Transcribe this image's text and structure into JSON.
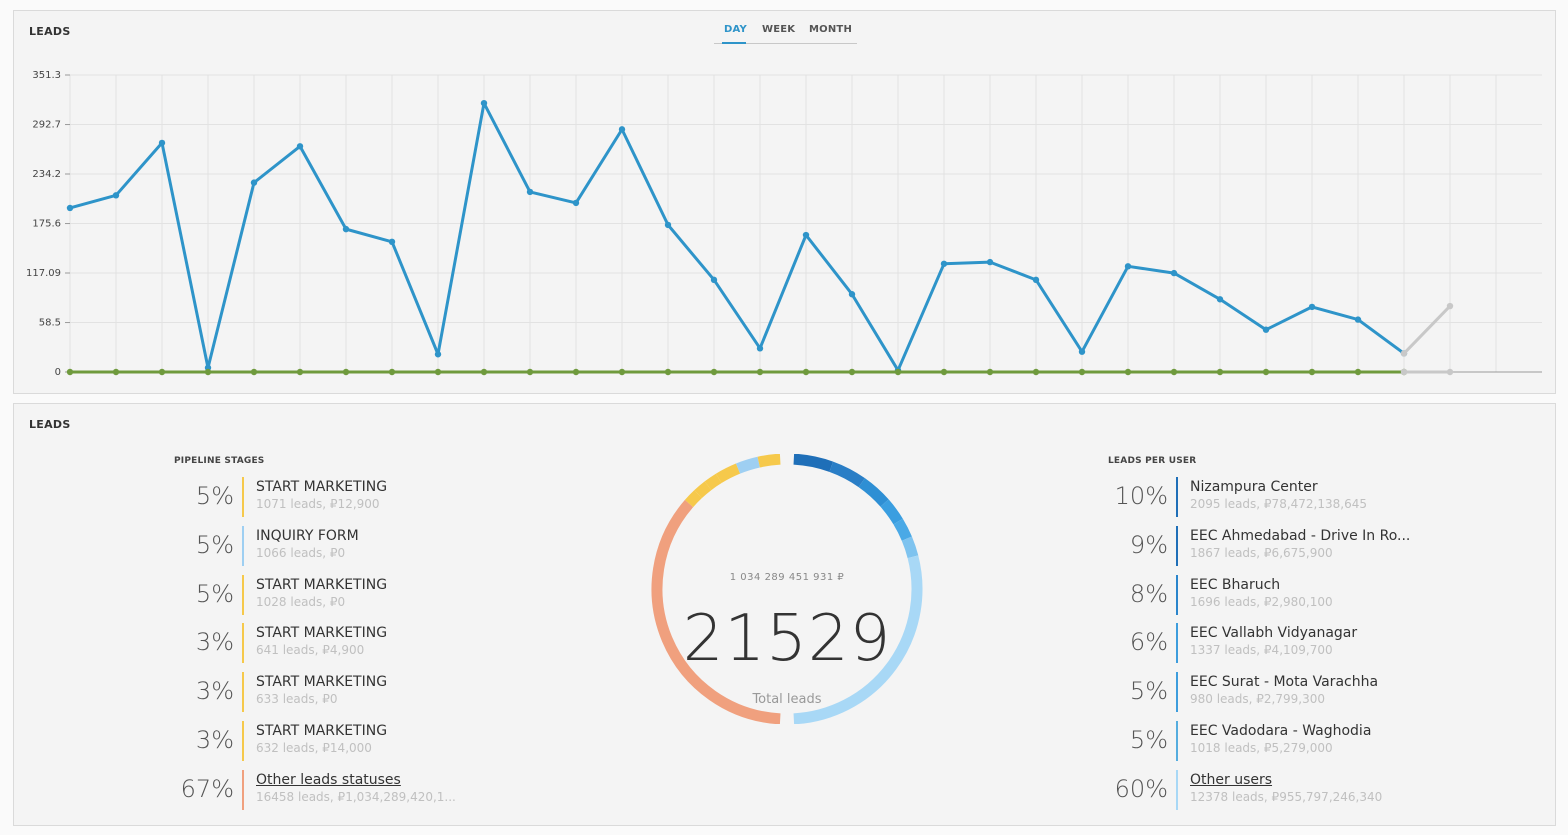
{
  "top_panel": {
    "title": "LEADS",
    "tabs": [
      {
        "label": "DAY",
        "active": true
      },
      {
        "label": "WEEK",
        "active": false
      },
      {
        "label": "MONTH",
        "active": false
      }
    ]
  },
  "chart_data": {
    "type": "line",
    "title": "LEADS",
    "x": [
      1,
      2,
      3,
      4,
      5,
      6,
      7,
      8,
      9,
      10,
      11,
      12,
      13,
      14,
      15,
      16,
      17,
      18,
      19,
      20,
      21,
      22,
      23,
      24,
      25,
      26,
      27,
      28,
      29,
      30,
      31,
      32
    ],
    "ylim": [
      0,
      351.3
    ],
    "y_ticks": [
      "0",
      "58.5",
      "117.09",
      "175.6",
      "234.2",
      "292.7",
      "351.3"
    ],
    "grid": true,
    "series": [
      {
        "color": "#2e94c9",
        "values": [
          194,
          209,
          271,
          5,
          224,
          267,
          169,
          154,
          21,
          318,
          213,
          200,
          287,
          174,
          109,
          28,
          162,
          92,
          2,
          128,
          130,
          109,
          24,
          125,
          117,
          86,
          50,
          77,
          62,
          22
        ]
      },
      {
        "color": "#c8c8c8",
        "values": [
          22,
          78
        ],
        "x_start": 30
      },
      {
        "color": "#6f9a3d",
        "values": [
          0,
          0,
          0,
          0,
          0,
          0,
          0,
          0,
          0,
          0,
          0,
          0,
          0,
          0,
          0,
          0,
          0,
          0,
          0,
          0,
          0,
          0,
          0,
          0,
          0,
          0,
          0,
          0,
          0,
          0
        ]
      },
      {
        "color": "#c8c8c8",
        "values": [
          0,
          0
        ],
        "x_start": 30
      }
    ]
  },
  "bottom_panel": {
    "title": "LEADS",
    "pipeline_label": "PIPELINE STAGES",
    "users_label": "LEADS PER USER",
    "pipeline_stages": [
      {
        "pct": "5%",
        "name": "START MARKETING",
        "sub": "1071 leads, ₽12,900",
        "color": "#f6c94b",
        "link": false
      },
      {
        "pct": "5%",
        "name": "INQUIRY FORM",
        "sub": "1066 leads, ₽0",
        "color": "#9ecff2",
        "link": false
      },
      {
        "pct": "5%",
        "name": "START MARKETING",
        "sub": "1028 leads, ₽0",
        "color": "#f6c94b",
        "link": false
      },
      {
        "pct": "3%",
        "name": "START MARKETING",
        "sub": "641 leads, ₽4,900",
        "color": "#f6c94b",
        "link": false
      },
      {
        "pct": "3%",
        "name": "START MARKETING",
        "sub": "633 leads, ₽0",
        "color": "#f6c94b",
        "link": false
      },
      {
        "pct": "3%",
        "name": "START MARKETING",
        "sub": "632 leads, ₽14,000",
        "color": "#f6c94b",
        "link": false
      },
      {
        "pct": "67%",
        "name": "Other leads statuses",
        "sub": "16458 leads, ₽1,034,289,420,1...",
        "color": "#f0a07e",
        "link": true
      }
    ],
    "leads_per_user": [
      {
        "pct": "10%",
        "name": "Nizampura Center",
        "sub": "2095 leads, ₽78,472,138,645",
        "color": "#1f6fb8",
        "link": false
      },
      {
        "pct": "9%",
        "name": "EEC Ahmedabad - Drive In Ro...",
        "sub": "1867 leads, ₽6,675,900",
        "color": "#1f6fb8",
        "link": false
      },
      {
        "pct": "8%",
        "name": "EEC Bharuch",
        "sub": "1696 leads, ₽2,980,100",
        "color": "#2a85cc",
        "link": false
      },
      {
        "pct": "6%",
        "name": "EEC Vallabh Vidyanagar",
        "sub": "1337 leads, ₽4,109,700",
        "color": "#3d9ddd",
        "link": false
      },
      {
        "pct": "5%",
        "name": "EEC Surat - Mota Varachha",
        "sub": "980 leads, ₽2,799,300",
        "color": "#3d9ddd",
        "link": false
      },
      {
        "pct": "5%",
        "name": "EEC Vadodara - Waghodia",
        "sub": "1018 leads, ₽5,279,000",
        "color": "#55addf",
        "link": false
      },
      {
        "pct": "60%",
        "name": "Other users",
        "sub": "12378 leads, ₽955,797,246,340",
        "color": "#a8d8f6",
        "link": true
      }
    ],
    "donut": {
      "amount": "1 034 289 451 931 ₽",
      "total": "21529",
      "caption": "Total leads",
      "left_segments": [
        {
          "value": 67,
          "color": "#f0a07e"
        },
        {
          "value": 3,
          "color": "#f6c94b"
        },
        {
          "value": 3,
          "color": "#f6c94b"
        },
        {
          "value": 3,
          "color": "#f6c94b"
        },
        {
          "value": 5,
          "color": "#f6c94b"
        },
        {
          "value": 5,
          "color": "#9ecff2"
        },
        {
          "value": 5,
          "color": "#f6c94b"
        }
      ],
      "right_segments": [
        {
          "value": 10,
          "color": "#1f6fb8"
        },
        {
          "value": 9,
          "color": "#2a7ec6"
        },
        {
          "value": 8,
          "color": "#2e8fd4"
        },
        {
          "value": 6,
          "color": "#3a9ee0"
        },
        {
          "value": 5,
          "color": "#4aa9e6"
        },
        {
          "value": 5,
          "color": "#7ec3ef"
        },
        {
          "value": 60,
          "color": "#a8d8f6"
        }
      ]
    }
  }
}
